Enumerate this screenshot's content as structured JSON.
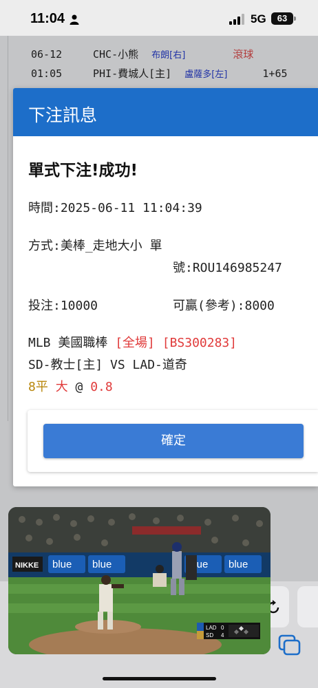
{
  "status_bar": {
    "time": "11:04",
    "network": "5G",
    "battery": "63"
  },
  "background": {
    "rows": [
      {
        "date": "06-12",
        "team": "CHC-小熊",
        "pitcher": "布朗[右]",
        "tag": "滾球",
        "extra": ""
      },
      {
        "date": "01:05",
        "team": "PHI-費城人[主]",
        "pitcher": "盧薩多[左]",
        "tag": "",
        "extra": "1+65"
      }
    ]
  },
  "modal": {
    "title": "下注訊息",
    "success": "單式下注!成功!",
    "time_line": "時間:2025-06-11 11:04:39",
    "method_line": "方式:美棒_走地大小 單",
    "ticket_line": "號:ROU146985247",
    "stake_line": "投注:10000",
    "win_line": "可贏(參考):8000",
    "league": "MLB 美國職棒",
    "scope": "[全場]",
    "code": "[BS300283]",
    "matchup": "SD-教士[主] VS LAD-道奇",
    "line": "8平",
    "side": "大",
    "at": "@",
    "odds": "0.8",
    "confirm_label": "確定"
  },
  "pip": {
    "scoreboard": {
      "away": "LAD",
      "away_score": "0",
      "home": "SD",
      "home_score": "4"
    },
    "ad_text": "blue",
    "brand_text": "NIKKE"
  },
  "colors": {
    "header_blue": "#1d6ec9",
    "button_blue": "#3a7bd5",
    "red": "#e03a3a",
    "gold": "#b8860b"
  }
}
